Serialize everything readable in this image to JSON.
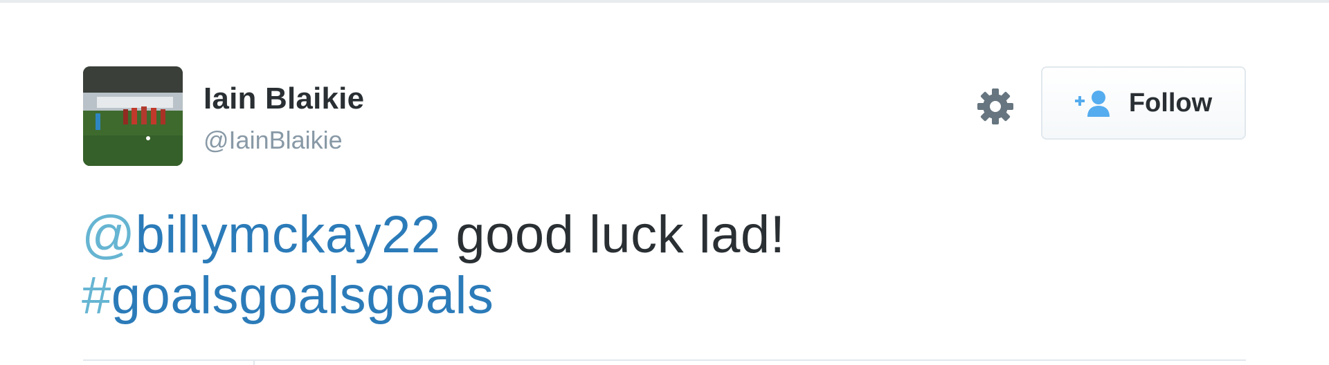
{
  "tweet": {
    "author": {
      "display_name": "Iain Blaikie",
      "screen_name": "@IainBlaikie",
      "avatar": "football-pitch-photo"
    },
    "settings_icon": "gear-icon",
    "follow_button": {
      "icon": "add-user-icon",
      "label": "Follow"
    },
    "text": {
      "mention_symbol": "@",
      "mention_name": "billymckay22",
      "body": " good luck lad!",
      "hashtag_symbol": "#",
      "hashtag_name": "goalsgoalsgoals"
    }
  },
  "colors": {
    "link": "#2b7bb9",
    "link_symbol": "#66b5d2",
    "text": "#292f33",
    "secondary": "#8899a6",
    "follow_icon": "#55acee",
    "gear": "#66757f"
  }
}
